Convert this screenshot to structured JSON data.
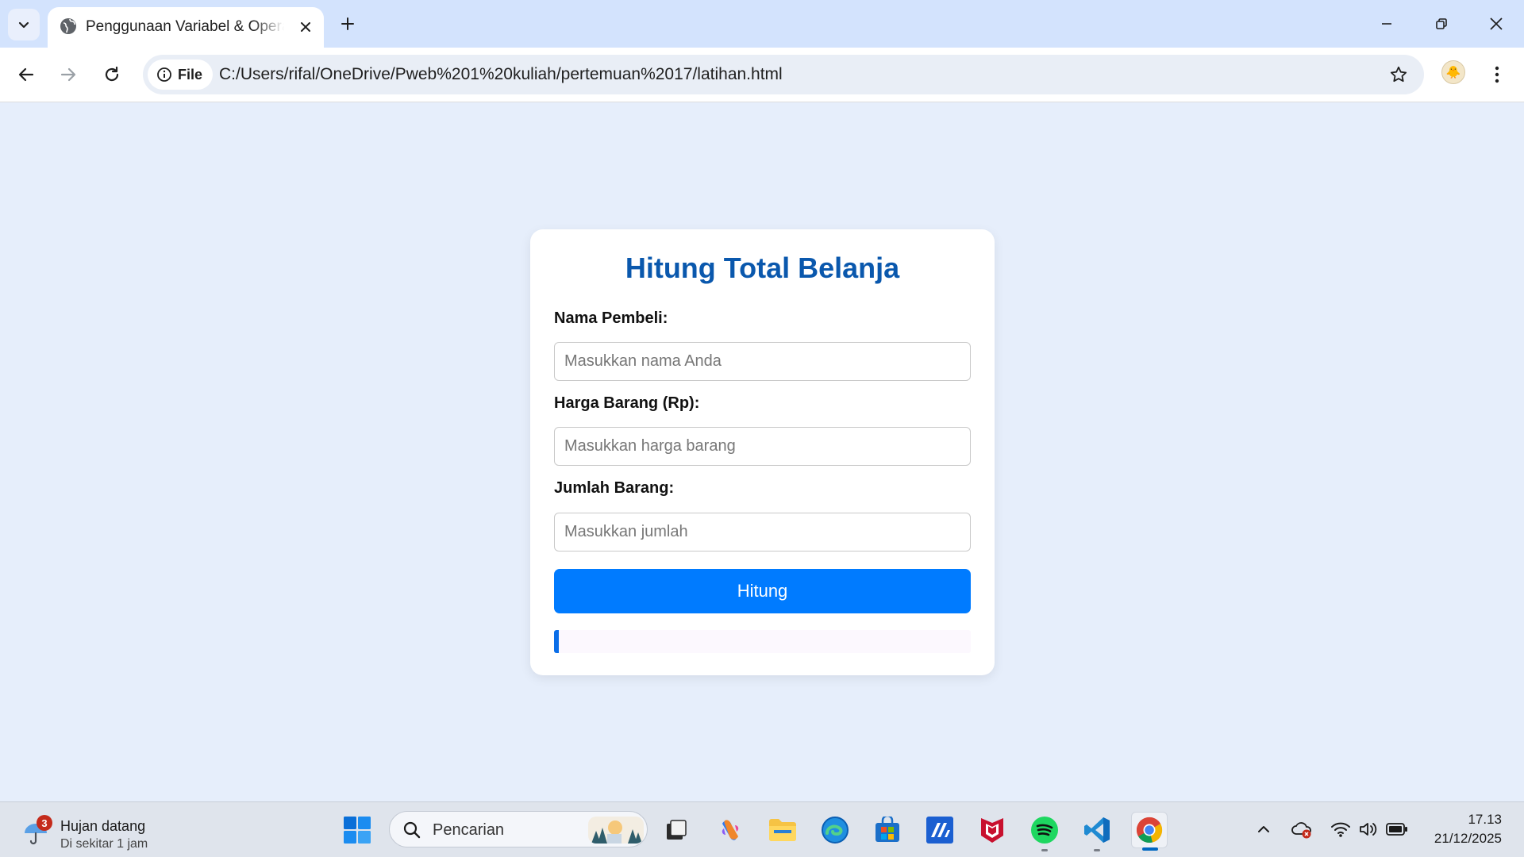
{
  "browser": {
    "tab": {
      "title": "Penggunaan Variabel & Operator",
      "favicon": "globe-icon"
    },
    "address": {
      "scheme_label": "File",
      "url": "C:/Users/rifal/OneDrive/Pweb%201%20kuliah/pertemuan%2017/latihan.html"
    }
  },
  "page": {
    "title": "Hitung Total Belanja",
    "fields": [
      {
        "label": "Nama Pembeli:",
        "placeholder": "Masukkan nama Anda",
        "value": ""
      },
      {
        "label": "Harga Barang (Rp):",
        "placeholder": "Masukkan harga barang",
        "value": ""
      },
      {
        "label": "Jumlah Barang:",
        "placeholder": "Masukkan jumlah",
        "value": ""
      }
    ],
    "submit_label": "Hitung",
    "result_text": "",
    "colors": {
      "accent": "#007bff",
      "title": "#0a58ad",
      "background": "#e6eefb"
    }
  },
  "taskbar": {
    "weather": {
      "title": "Hujan datang",
      "subtitle": "Di sekitar 1 jam",
      "badge": "3",
      "icon": "umbrella-icon"
    },
    "search_placeholder": "Pencarian",
    "apps": [
      "task-view",
      "copilot",
      "file-explorer",
      "edge",
      "microsoft-store",
      "malwarebytes",
      "mcafee",
      "spotify",
      "vscode",
      "chrome"
    ],
    "clock": {
      "time": "17.13",
      "date": "21/12/2025"
    }
  }
}
